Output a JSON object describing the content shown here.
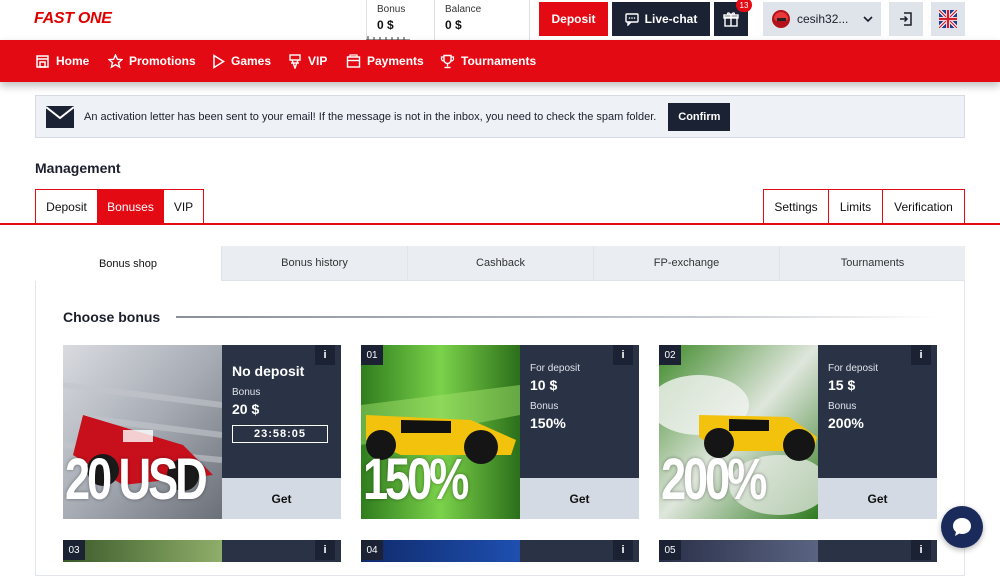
{
  "brand": {
    "logo": "FAST ONE",
    "accent": "#e30a13",
    "dark": "#1b2233"
  },
  "wallet": {
    "bonus_label": "Bonus",
    "bonus_value": "0 $",
    "balance_label": "Balance",
    "balance_value": "0 $"
  },
  "header": {
    "deposit_label": "Deposit",
    "livechat_label": "Live-chat",
    "gift_icon": "gift-icon",
    "gift_badge": "13",
    "username": "cesih32...",
    "logout_icon": "logout-icon",
    "language_icon": "uk-flag-icon"
  },
  "nav": {
    "items": [
      {
        "label": "Home",
        "icon": "home-icon"
      },
      {
        "label": "Promotions",
        "icon": "star-icon"
      },
      {
        "label": "Games",
        "icon": "play-icon"
      },
      {
        "label": "VIP",
        "icon": "vip-icon"
      },
      {
        "label": "Payments",
        "icon": "wallet-icon"
      },
      {
        "label": "Tournaments",
        "icon": "trophy-icon"
      }
    ]
  },
  "alert": {
    "icon": "envelope-icon",
    "text": "An activation letter has been sent to your email! If the message is not in the inbox, you need to check the spam folder.",
    "confirm_label": "Confirm"
  },
  "management": {
    "title": "Management",
    "left_tabs": [
      {
        "label": "Deposit",
        "active": false
      },
      {
        "label": "Bonuses",
        "active": true
      },
      {
        "label": "VIP",
        "active": false
      }
    ],
    "right_tabs": [
      {
        "label": "Settings"
      },
      {
        "label": "Limits"
      },
      {
        "label": "Verification"
      }
    ]
  },
  "subtabs": [
    {
      "label": "Bonus shop",
      "active": true
    },
    {
      "label": "Bonus history",
      "active": false
    },
    {
      "label": "Cashback",
      "active": false
    },
    {
      "label": "FP-exchange",
      "active": false
    },
    {
      "label": "Tournaments",
      "active": false
    }
  ],
  "bonus_shop": {
    "title": "Choose bonus",
    "cards": [
      {
        "number": "",
        "image_text": "20 USD",
        "title": "No deposit",
        "bonus_label": "Bonus",
        "bonus_value": "20 $",
        "timer": "23:58:05",
        "info": "i",
        "get_label": "Get"
      },
      {
        "number": "01",
        "image_text": "150%",
        "deposit_label": "For deposit",
        "deposit_value": "10 $",
        "bonus_label": "Bonus",
        "bonus_value": "150%",
        "info": "i",
        "get_label": "Get"
      },
      {
        "number": "02",
        "image_text": "200%",
        "deposit_label": "For deposit",
        "deposit_value": "15 $",
        "bonus_label": "Bonus",
        "bonus_value": "200%",
        "info": "i",
        "get_label": "Get"
      },
      {
        "number": "03",
        "info": "i"
      },
      {
        "number": "04",
        "info": "i"
      },
      {
        "number": "05",
        "info": "i"
      }
    ]
  },
  "chat_widget": {
    "icon": "chat-bubble-icon"
  }
}
